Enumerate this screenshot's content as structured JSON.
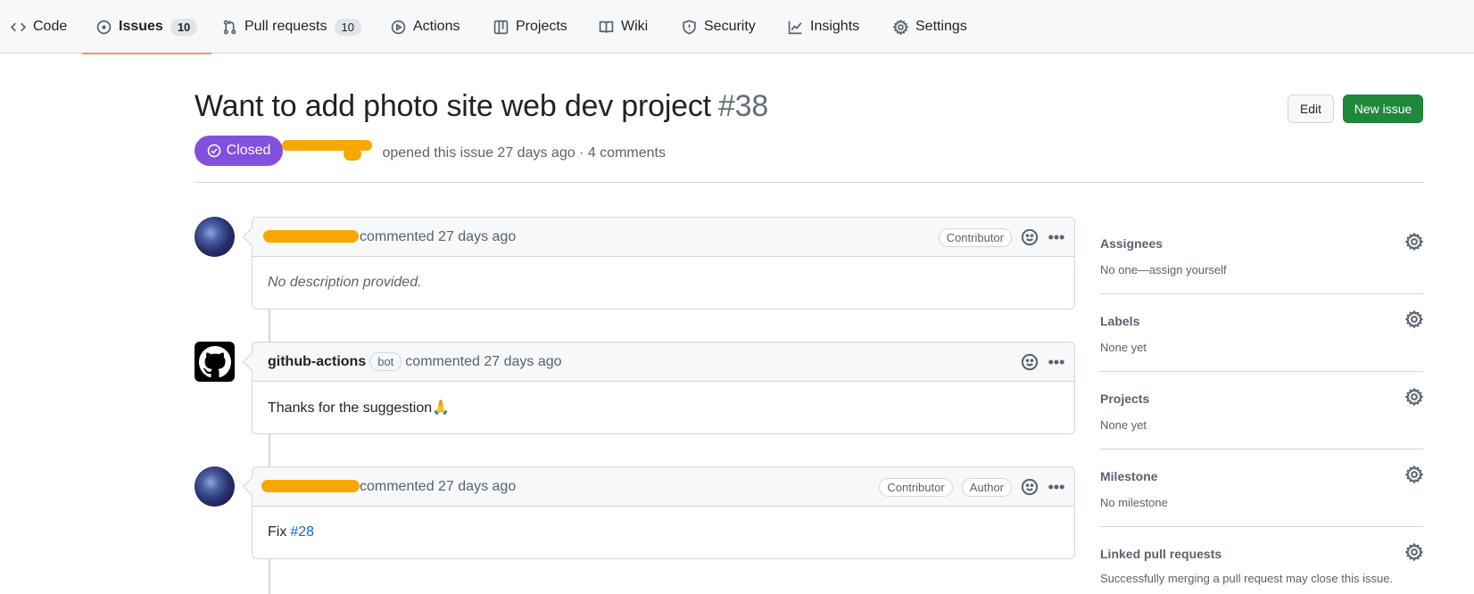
{
  "nav": {
    "code": "Code",
    "issues": "Issues",
    "issues_count": "10",
    "pull_requests": "Pull requests",
    "pull_requests_count": "10",
    "actions": "Actions",
    "projects": "Projects",
    "wiki": "Wiki",
    "security": "Security",
    "insights": "Insights",
    "settings": "Settings"
  },
  "issue": {
    "title": "Want to add photo site web dev project",
    "number": "#38",
    "state": "Closed",
    "meta": "opened this issue 27 days ago · 4 comments",
    "edit_label": "Edit",
    "new_issue_label": "New issue"
  },
  "comments": [
    {
      "action": "commented 27 days ago",
      "roles": [
        "Contributor"
      ],
      "body": "No description provided."
    },
    {
      "author": "github-actions",
      "badge": "bot",
      "action": "commented 27 days ago",
      "body": "Thanks for the suggestion🙏"
    },
    {
      "action": "commented 27 days ago",
      "roles": [
        "Contributor",
        "Author"
      ],
      "body_prefix": "Fix",
      "body_link": "#28"
    }
  ],
  "sidebar": {
    "assignees": {
      "title": "Assignees",
      "value": "No one—assign yourself"
    },
    "labels": {
      "title": "Labels",
      "value": "None yet"
    },
    "projects": {
      "title": "Projects",
      "value": "None yet"
    },
    "milestone": {
      "title": "Milestone",
      "value": "No milestone"
    },
    "linked_prs": {
      "title": "Linked pull requests",
      "value": "Successfully merging a pull request may close this issue."
    }
  },
  "colors": {
    "closed_badge": "#8250df",
    "new_issue_button": "#1f883d",
    "active_tab_underline": "#fd8c73",
    "redaction": "#f7a800",
    "link": "#0969da"
  }
}
